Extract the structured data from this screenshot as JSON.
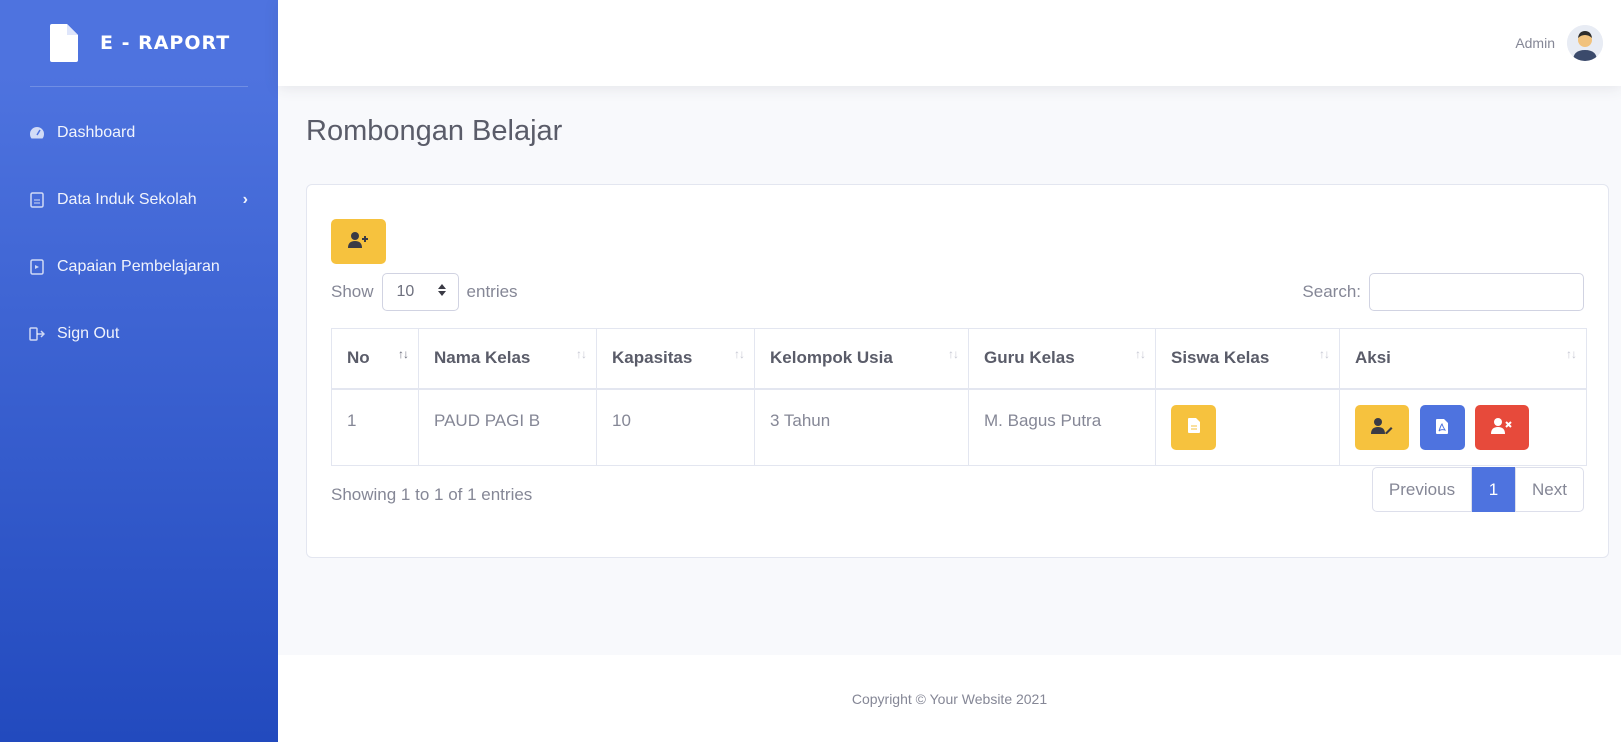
{
  "brand": {
    "name": "E - RAPORT"
  },
  "sidebar": {
    "items": [
      {
        "label": "Dashboard",
        "icon": "gauge-icon"
      },
      {
        "label": "Data Induk Sekolah",
        "icon": "file-icon"
      },
      {
        "label": "Capaian Pembelajaran",
        "icon": "file-icon"
      },
      {
        "label": "Sign Out",
        "icon": "sign-out-icon"
      }
    ]
  },
  "topbar": {
    "user": "Admin"
  },
  "page": {
    "title": "Rombongan Belajar"
  },
  "table_controls": {
    "show": "Show",
    "length_value": "10",
    "entries": "entries",
    "search_label": "Search:",
    "search_value": ""
  },
  "table": {
    "columns": [
      "No",
      "Nama Kelas",
      "Kapasitas",
      "Kelompok Usia",
      "Guru Kelas",
      "Siswa Kelas",
      "Aksi"
    ],
    "rows": [
      {
        "no": "1",
        "nama_kelas": "PAUD PAGI B",
        "kapasitas": "10",
        "kelompok_usia": "3 Tahun",
        "guru_kelas": "M. Bagus Putra"
      }
    ]
  },
  "info": "Showing 1 to 1 of 1 entries",
  "pagination": {
    "previous": "Previous",
    "current": "1",
    "next": "Next"
  },
  "footer": "Copyright © Your Website 2021",
  "colors": {
    "primary": "#4e73df",
    "warning": "#f6c23e",
    "danger": "#e74a3b"
  }
}
